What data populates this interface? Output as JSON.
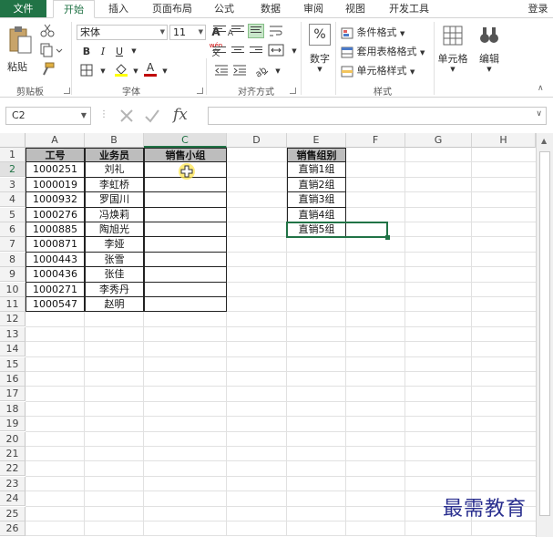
{
  "tabs": [
    {
      "label": "文件"
    },
    {
      "label": "开始"
    },
    {
      "label": "插入"
    },
    {
      "label": "页面布局"
    },
    {
      "label": "公式"
    },
    {
      "label": "数据"
    },
    {
      "label": "审阅"
    },
    {
      "label": "视图"
    },
    {
      "label": "开发工具"
    }
  ],
  "login_label": "登录",
  "ribbon": {
    "clipboard": {
      "paste_label": "粘贴",
      "group_label": "剪贴板"
    },
    "font": {
      "font_name": "宋体",
      "font_size": "11",
      "group_label": "字体",
      "bold": "B",
      "italic": "I",
      "underline": "U",
      "grow": "A",
      "shrink": "A",
      "phonetic_top": "wén",
      "phonetic_bottom": "文",
      "font_color": "A"
    },
    "alignment": {
      "group_label": "对齐方式"
    },
    "number": {
      "label": "数字",
      "symbol": "%"
    },
    "styles": {
      "conditional": "条件格式",
      "table_format": "套用表格格式",
      "cell_styles": "单元格样式",
      "group_label": "样式"
    },
    "cells": {
      "label": "单元格"
    },
    "editing": {
      "label": "编辑"
    }
  },
  "formula_bar": {
    "name_box": "C2",
    "fx": "fx",
    "value": ""
  },
  "columns": [
    "A",
    "B",
    "C",
    "D",
    "E",
    "F",
    "G",
    "H"
  ],
  "rows": [
    "1",
    "2",
    "3",
    "4",
    "5",
    "6",
    "7",
    "8",
    "9",
    "10",
    "11",
    "12",
    "13",
    "14",
    "15",
    "16",
    "17",
    "18",
    "19",
    "20",
    "21",
    "22",
    "23",
    "24",
    "25",
    "26"
  ],
  "table": {
    "headers": [
      "工号",
      "业务员",
      "销售小组"
    ],
    "rows": [
      [
        "1000251",
        "刘礼",
        ""
      ],
      [
        "1000019",
        "李虹桥",
        ""
      ],
      [
        "1000932",
        "罗国川",
        ""
      ],
      [
        "1000276",
        "冯焕莉",
        ""
      ],
      [
        "1000885",
        "陶旭光",
        ""
      ],
      [
        "1000871",
        "李娅",
        ""
      ],
      [
        "1000443",
        "张雪",
        ""
      ],
      [
        "1000436",
        "张佳",
        ""
      ],
      [
        "1000271",
        "李秀丹",
        ""
      ],
      [
        "1000547",
        "赵明",
        ""
      ]
    ]
  },
  "groups_table": {
    "header": "销售组别",
    "items": [
      "直销1组",
      "直销2组",
      "直销3组",
      "直销4组",
      "直销5组"
    ]
  },
  "watermark": "最需教育",
  "colors": {
    "accent": "#217346",
    "header_fill": "#bdbdbd"
  }
}
